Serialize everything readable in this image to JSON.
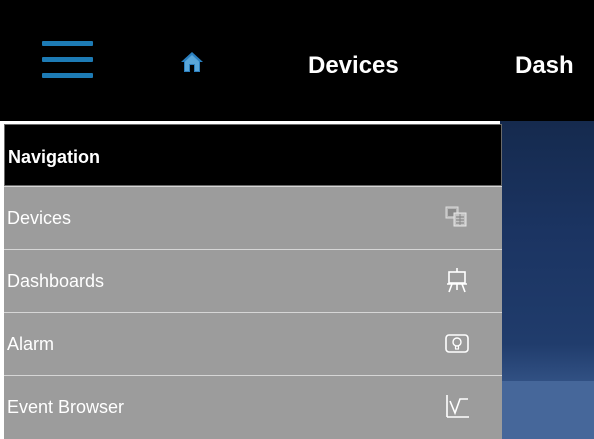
{
  "topbar": {
    "menu_icon": "hamburger-icon",
    "home_icon": "home-icon",
    "title_devices": "Devices",
    "title_dash": "Dash"
  },
  "nav": {
    "header": "Navigation",
    "items": [
      {
        "label": "Devices",
        "icon": "devices-icon"
      },
      {
        "label": "Dashboards",
        "icon": "easel-icon"
      },
      {
        "label": "Alarm",
        "icon": "alarm-bulb-icon"
      },
      {
        "label": "Event Browser",
        "icon": "chart-icon"
      }
    ]
  },
  "colors": {
    "topbar_bg": "#000000",
    "accent": "#1d7bb5",
    "nav_item_bg": "#9c9c9c",
    "content_bg": "#1b3462"
  }
}
